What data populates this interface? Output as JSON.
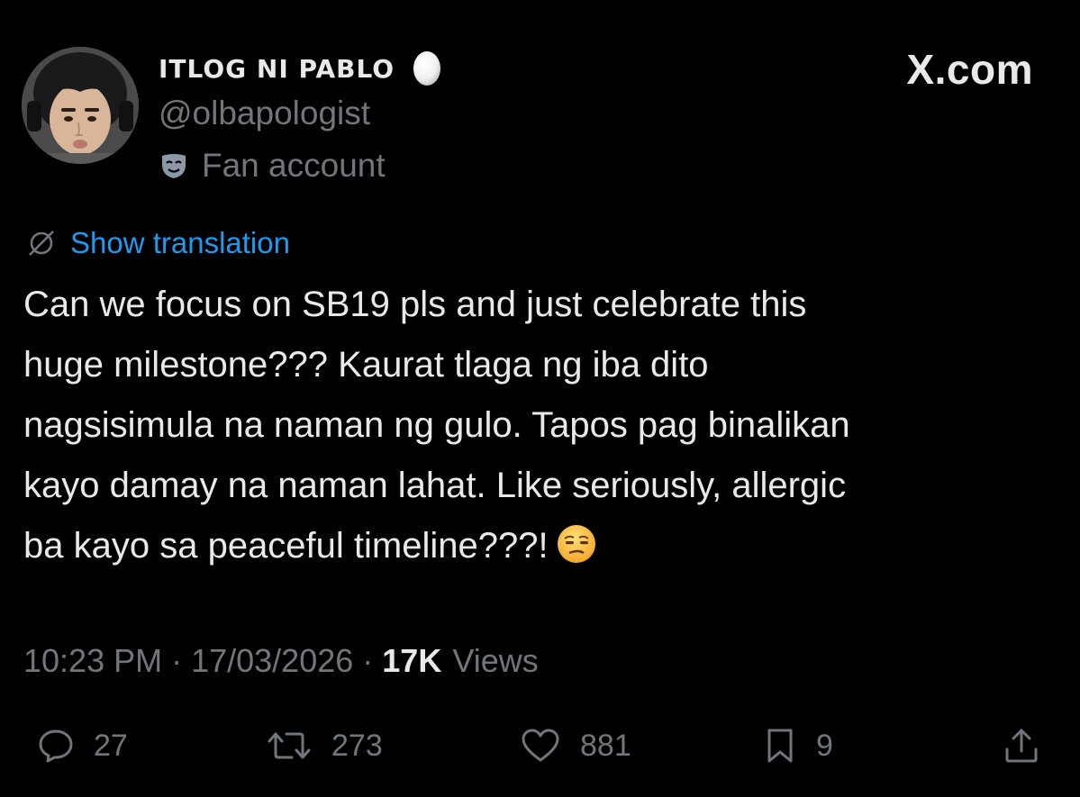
{
  "author": {
    "display_name": "ITLOG NI PABLO",
    "handle": "@olbapologist",
    "label": "Fan account"
  },
  "brand": {
    "site": "X.com"
  },
  "translation": {
    "link_text": "Show translation"
  },
  "tweet": {
    "lines": [
      "Can we focus on SB19 pls and just celebrate this",
      "huge milestone??? Kaurat tlaga ng iba dito",
      "nagsisimula na naman ng gulo. Tapos pag binalikan",
      "kayo damay na naman lahat. Like seriously, allergic",
      "ba kayo sa peaceful timeline???!"
    ],
    "emoji": "unamused-face"
  },
  "meta": {
    "time": "10:23 PM",
    "separator": "·",
    "date": "17/03/2026",
    "views_count": "17K",
    "views_label": "Views"
  },
  "actions": {
    "replies": "27",
    "reposts": "273",
    "likes": "881",
    "bookmarks": "9"
  },
  "icons": {
    "reply": "speech-bubble-icon",
    "repost": "repost-arrows-icon",
    "like": "heart-icon",
    "bookmark": "bookmark-icon",
    "share": "share-upload-icon",
    "translate": "globe-slash-icon",
    "affiliation": "mask-icon",
    "badge": "egg-icon"
  },
  "colors": {
    "background": "#000000",
    "text_primary": "#e7e9ea",
    "text_secondary": "#71767b",
    "link": "#1d9bf0"
  }
}
